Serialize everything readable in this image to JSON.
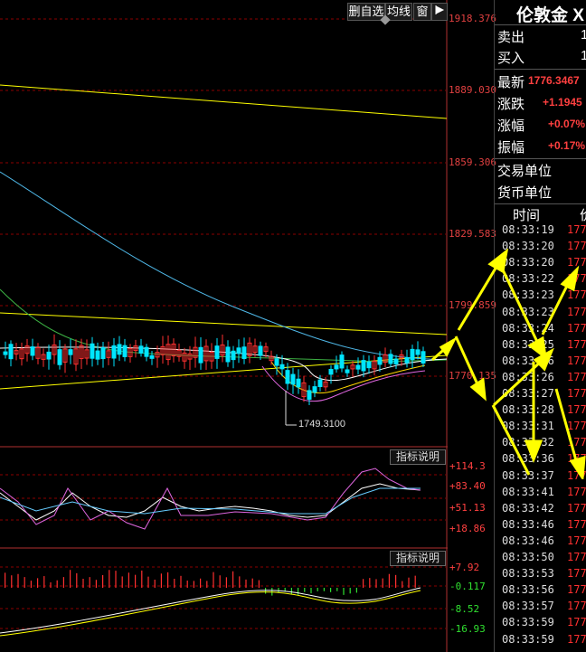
{
  "toolbar": {
    "delete_watch": "删自选",
    "moving_avg": "均线",
    "window": "窗",
    "pin_icon": "pin-icon"
  },
  "price_axis": [
    "1918.376",
    "1889.030",
    "1859.306",
    "1829.583",
    "1799.859",
    "1770.135"
  ],
  "low_annotation": "1749.3100",
  "indicator1": {
    "button": "指标说明",
    "labels": [
      "+114.3",
      "+83.40",
      "+51.13",
      "+18.86"
    ]
  },
  "indicator2": {
    "button": "指标说明",
    "labels": [
      "+7.92",
      "-0.117",
      "-8.52",
      "-16.93"
    ]
  },
  "quote": {
    "title": "伦敦金 X",
    "sell_label": "卖出",
    "sell_value": "1",
    "buy_label": "买入",
    "buy_value": "1",
    "last_label": "最新",
    "last_value": "1776.3467",
    "change_label": "涨跌",
    "change_value": "+1.1945",
    "pct_label": "涨幅",
    "pct_value": "+0.07%",
    "amp_label": "振幅",
    "amp_value": "+0.17%",
    "unit_label": "交易单位",
    "currency_label": "货币单位",
    "col_time": "时间",
    "col_price": "价"
  },
  "ticks": [
    {
      "t": "08:33:19",
      "p": "177"
    },
    {
      "t": "08:33:20",
      "p": "177"
    },
    {
      "t": "08:33:20",
      "p": "177"
    },
    {
      "t": "08:33:22",
      "p": "177"
    },
    {
      "t": "08:33:23",
      "p": "177"
    },
    {
      "t": "08:33:23",
      "p": "177"
    },
    {
      "t": "08:33:24",
      "p": "177"
    },
    {
      "t": "08:33:25",
      "p": "177"
    },
    {
      "t": "08:33:26",
      "p": "177"
    },
    {
      "t": "08:33:26",
      "p": "177"
    },
    {
      "t": "08:33:27",
      "p": "177"
    },
    {
      "t": "08:33:28",
      "p": "177"
    },
    {
      "t": "08:33:31",
      "p": "177"
    },
    {
      "t": "08:33:32",
      "p": "177"
    },
    {
      "t": "08:33:36",
      "p": "177"
    },
    {
      "t": "08:33:37",
      "p": "177"
    },
    {
      "t": "08:33:41",
      "p": "177"
    },
    {
      "t": "08:33:42",
      "p": "177"
    },
    {
      "t": "08:33:46",
      "p": "177"
    },
    {
      "t": "08:33:46",
      "p": "177"
    },
    {
      "t": "08:33:50",
      "p": "177"
    },
    {
      "t": "08:33:53",
      "p": "177"
    },
    {
      "t": "08:33:56",
      "p": "177"
    },
    {
      "t": "08:33:57",
      "p": "177"
    },
    {
      "t": "08:33:59",
      "p": "177"
    },
    {
      "t": "08:33:59",
      "p": "177"
    }
  ],
  "colors": {
    "up": "#ff3030",
    "down": "#00e5ff",
    "yellow": "#ffff00",
    "grid": "#8b0000",
    "axis": "#e04040"
  }
}
